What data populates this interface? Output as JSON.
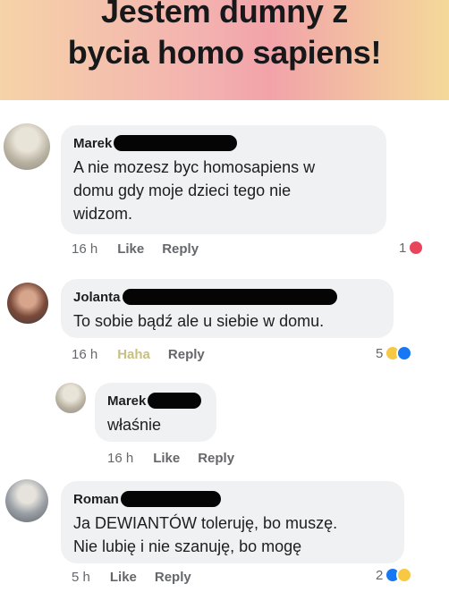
{
  "banner": {
    "line1": "Jestem dumny z",
    "line2": "bycia homo sapiens!"
  },
  "comments": [
    {
      "name": "Marek",
      "text_lines": [
        "A nie mozesz byc homosapiens w",
        "domu gdy moje dzieci tego nie",
        "widzom."
      ],
      "time": "16 h",
      "like": "Like",
      "reply": "Reply",
      "reaction_count": "1",
      "reactions": [
        "love-icon"
      ]
    },
    {
      "name": "Jolanta",
      "text_lines": [
        "To sobie bądź ale u siebie w domu."
      ],
      "time": "16 h",
      "like": "Haha",
      "reply": "Reply",
      "reaction_count": "5",
      "reactions": [
        "haha-icon",
        "like-icon"
      ]
    },
    {
      "name": "Marek",
      "text_lines": [
        "właśnie"
      ],
      "time": "16 h",
      "like": "Like",
      "reply": "Reply"
    },
    {
      "name": "Roman",
      "text_lines": [
        "Ja DEWIANTÓW toleruję, bo muszę.",
        "Nie lubię i nie szanuję, bo mogę"
      ],
      "time": "5 h",
      "like": "Like",
      "reply": "Reply",
      "reaction_count": "2",
      "reactions": [
        "like-icon",
        "haha-icon"
      ]
    }
  ],
  "colors": {
    "bubble": "#eff1f3",
    "meta_text": "#65676b",
    "haha_label": "#c7c082",
    "love": "#e8455b",
    "like": "#1877f2",
    "haha": "#f7c843"
  }
}
